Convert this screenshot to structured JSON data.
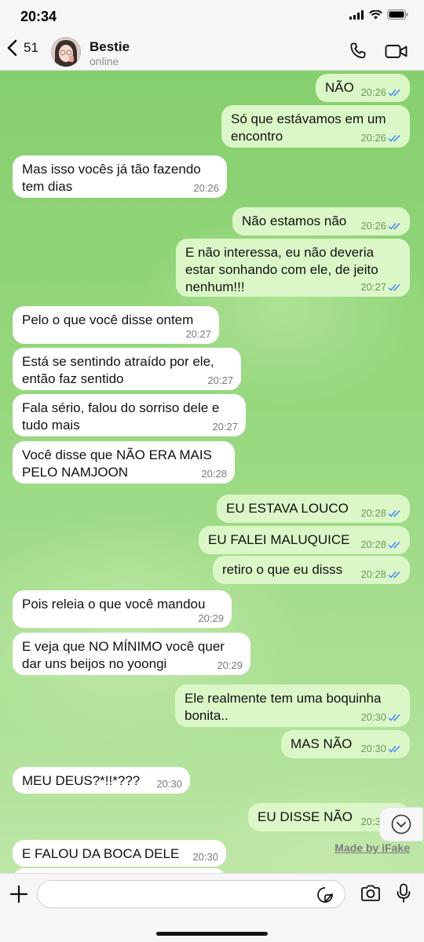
{
  "status_bar": {
    "time": "20:34"
  },
  "header": {
    "back_count": "51",
    "contact_name": "Bestie",
    "contact_status": "online"
  },
  "messages": [
    {
      "dir": "out",
      "text": "NÃO",
      "time": "20:26",
      "read": true
    },
    {
      "dir": "out",
      "text": "Só que estávamos em um encontro",
      "time": "20:26",
      "read": true
    },
    {
      "dir": "in",
      "text": "Mas isso vocês já tão fazendo tem dias",
      "time": "20:26"
    },
    {
      "dir": "out",
      "text": "Não estamos não",
      "time": "20:26",
      "read": true
    },
    {
      "dir": "out",
      "text": "E não interessa, eu não deveria estar sonhando com ele, de jeito nenhum!!!",
      "time": "20:27",
      "read": true
    },
    {
      "dir": "in",
      "text": "Pelo o que você disse ontem",
      "time": "20:27"
    },
    {
      "dir": "in",
      "text": "Está se sentindo atraído por ele, então faz sentido",
      "time": "20:27"
    },
    {
      "dir": "in",
      "text": "Fala sério, falou do sorriso dele e tudo mais",
      "time": "20:27"
    },
    {
      "dir": "in",
      "text": "Você disse que NÃO ERA MAIS PELO NAMJOON",
      "time": "20:28"
    },
    {
      "dir": "out",
      "text": "EU ESTAVA LOUCO",
      "time": "20:28",
      "read": true
    },
    {
      "dir": "out",
      "text": "EU FALEI MALUQUICE",
      "time": "20:28",
      "read": true
    },
    {
      "dir": "out",
      "text": "retiro o que eu disss",
      "time": "20:28",
      "read": true
    },
    {
      "dir": "in",
      "text": "Pois releia o que você mandou",
      "time": "20:29"
    },
    {
      "dir": "in",
      "text": "E veja que NO MÍNIMO você quer dar uns beijos no yoongi",
      "time": "20:29"
    },
    {
      "dir": "out",
      "text": "Ele realmente tem uma boquinha bonita..",
      "time": "20:30",
      "read": true
    },
    {
      "dir": "out",
      "text": "MAS NÃO",
      "time": "20:30",
      "read": true
    },
    {
      "dir": "in",
      "text": "MEU DEUS?*!!*???",
      "time": "20:30"
    },
    {
      "dir": "out",
      "text": "EU DISSE NÃO",
      "time": "20:30",
      "read": true
    },
    {
      "dir": "in",
      "text": "E FALOU DA BOCA DELE",
      "time": "20:30"
    }
  ],
  "watermark": "Made by iFake",
  "composer": {
    "placeholder": "",
    "value": ""
  },
  "icons": {
    "back": "chevron-left-icon",
    "call": "phone-icon",
    "video": "video-camera-icon",
    "plus": "plus-icon",
    "sticker": "sticker-icon",
    "camera": "camera-icon",
    "mic": "microphone-icon",
    "scroll": "chevron-down-icon"
  },
  "colors": {
    "chat_background": "#96d77e",
    "incoming_bubble": "#ffffff",
    "outgoing_bubble": "#dbf7c7",
    "read_ticks": "#3b82f6"
  }
}
